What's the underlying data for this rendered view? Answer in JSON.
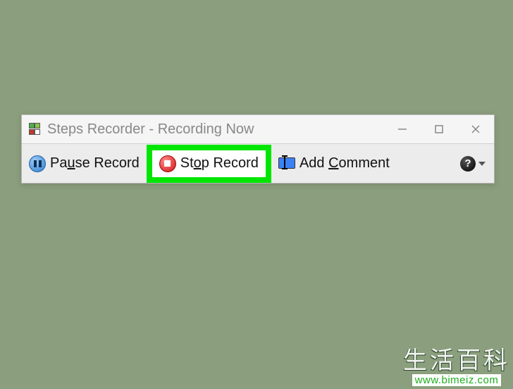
{
  "window": {
    "title": "Steps Recorder - Recording Now"
  },
  "toolbar": {
    "pause": {
      "pre": "Pa",
      "u": "u",
      "post": "se Record"
    },
    "stop": {
      "pre": "St",
      "u": "o",
      "post": "p Record"
    },
    "comment": {
      "pre": "Add ",
      "u": "C",
      "post": "omment"
    },
    "help": {
      "symbol": "?"
    }
  },
  "watermark": {
    "text": "生活百科",
    "url": "www.bimeiz.com"
  }
}
